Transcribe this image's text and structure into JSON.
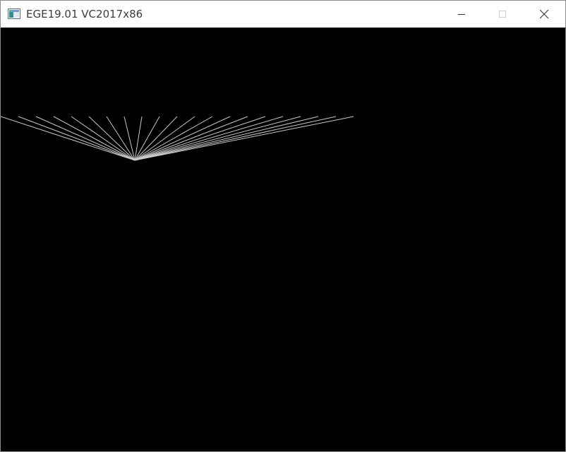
{
  "window": {
    "title": "EGE19.01 VC2017x86",
    "icon": "app-window-icon",
    "controls": [
      {
        "name": "minimize",
        "icon": "minimize-icon"
      },
      {
        "name": "maximize",
        "icon": "maximize-icon",
        "disabled": true
      },
      {
        "name": "close",
        "icon": "close-icon"
      }
    ]
  },
  "canvas": {
    "background": "#000000",
    "line_color": "#c8c8c8"
  }
}
